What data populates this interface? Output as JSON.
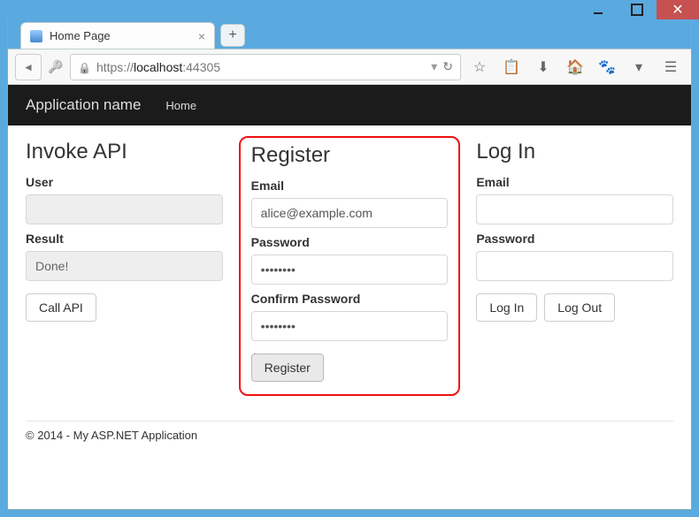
{
  "window": {
    "tab_title": "Home Page"
  },
  "addressbar": {
    "scheme": "https://",
    "host": "localhost",
    "port": ":44305"
  },
  "appnav": {
    "brand": "Application name",
    "home": "Home"
  },
  "invoke": {
    "heading": "Invoke API",
    "user_label": "User",
    "user_value": "",
    "result_label": "Result",
    "result_value": "Done!",
    "call_btn": "Call API"
  },
  "register": {
    "heading": "Register",
    "email_label": "Email",
    "email_value": "alice@example.com",
    "password_label": "Password",
    "password_value": "••••••••",
    "confirm_label": "Confirm Password",
    "confirm_value": "••••••••",
    "submit": "Register"
  },
  "login": {
    "heading": "Log In",
    "email_label": "Email",
    "email_value": "",
    "password_label": "Password",
    "password_value": "",
    "login_btn": "Log In",
    "logout_btn": "Log Out"
  },
  "footer": "© 2014 - My ASP.NET Application"
}
